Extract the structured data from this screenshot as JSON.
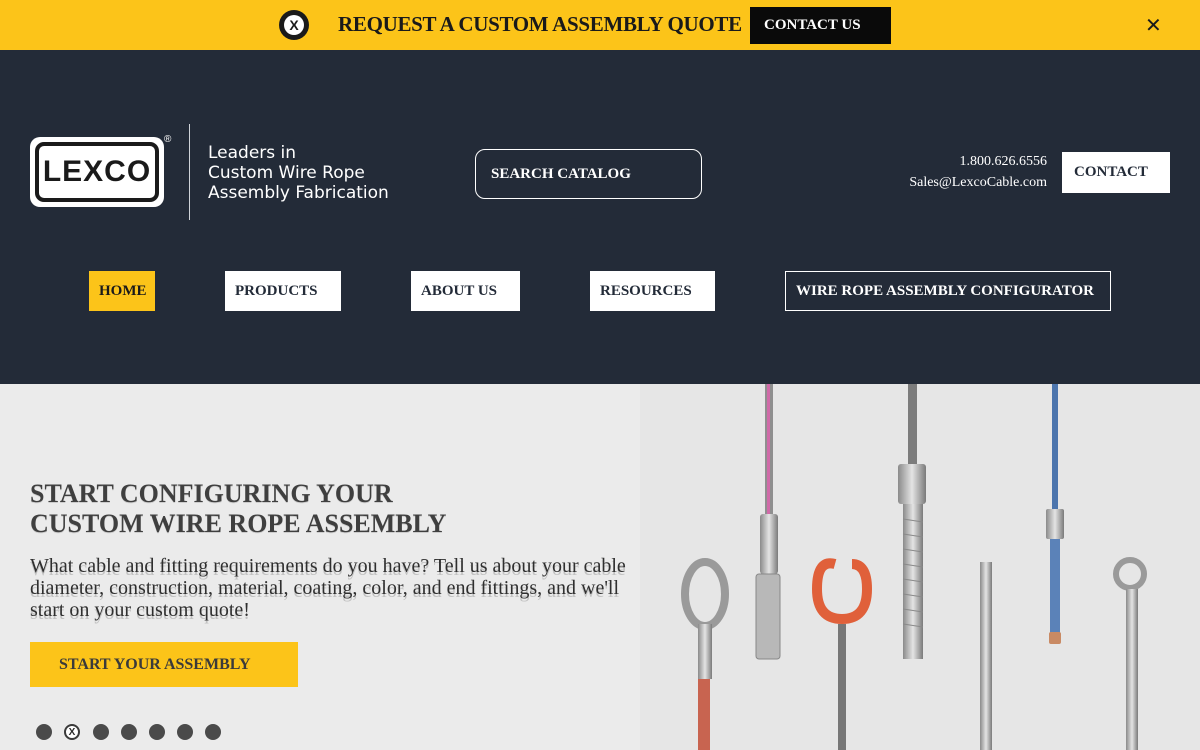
{
  "banner": {
    "logo_icon": "lexco-emblem-icon",
    "logo_glyph": "X",
    "title": "REQUEST A CUSTOM ASSEMBLY QUOTE",
    "contact_label": "CONTACT US",
    "close_glyph": "✕",
    "background": "#fcc419"
  },
  "header": {
    "logo_text": "LEXCO",
    "logo_reg": "®",
    "tagline": [
      "Leaders in",
      "Custom Wire Rope",
      "Assembly Fabrication"
    ],
    "search_label": "SEARCH CATALOG",
    "phone": "1.800.626.6556",
    "email": "Sales@LexcoCable.com",
    "contact_label": "CONTACT",
    "background": "#232b38"
  },
  "nav": {
    "home": "HOME",
    "products": "PRODUCTS",
    "about": "ABOUT US",
    "resources": "RESOURCES",
    "configurator": "WIRE ROPE ASSEMBLY CONFIGURATOR"
  },
  "hero": {
    "title_line1": "START CONFIGURING YOUR",
    "title_line2": "CUSTOM WIRE ROPE ASSEMBLY",
    "text": "What cable and fitting requirements do you have? Tell us about your cable diameter, construction, material, coating, color, and end fittings, and we'll start on your custom quote!",
    "cta_label": "START YOUR ASSEMBLY",
    "slide_count": 7,
    "active_slide": 2,
    "active_glyph": "X",
    "accent": "#fcc419"
  }
}
